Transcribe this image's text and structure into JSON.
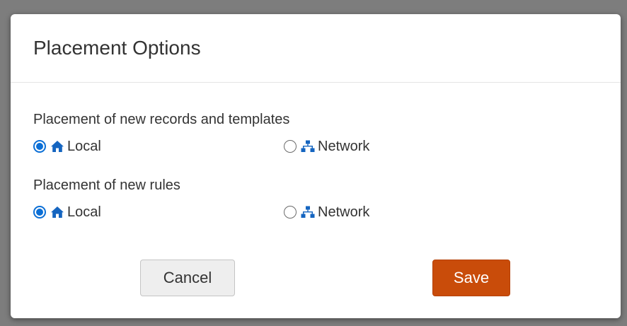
{
  "dialog": {
    "title": "Placement Options"
  },
  "groups": [
    {
      "label": "Placement of new records and templates",
      "options": [
        {
          "label": "Local",
          "icon": "home-icon",
          "selected": true
        },
        {
          "label": "Network",
          "icon": "sitemap-icon",
          "selected": false
        }
      ]
    },
    {
      "label": "Placement of new rules",
      "options": [
        {
          "label": "Local",
          "icon": "home-icon",
          "selected": true
        },
        {
          "label": "Network",
          "icon": "sitemap-icon",
          "selected": false
        }
      ]
    }
  ],
  "buttons": {
    "cancel_label": "Cancel",
    "save_label": "Save"
  },
  "colors": {
    "accent_blue": "#0b6fd6",
    "save_orange": "#c94c0a",
    "icon_blue": "#1565c0"
  }
}
